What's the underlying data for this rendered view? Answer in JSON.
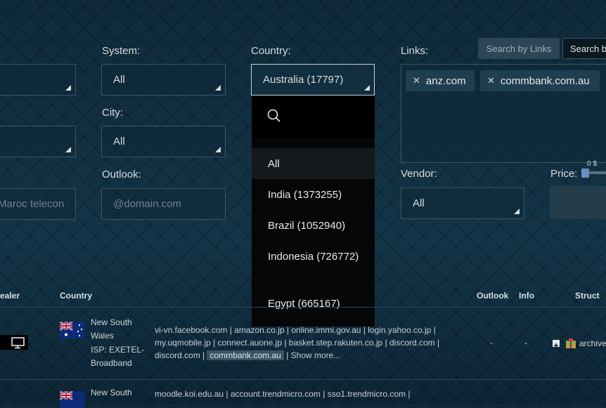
{
  "filters": {
    "left_col": {
      "isp_value": "Maroc telecon"
    },
    "system": {
      "label": "System:",
      "value": "All"
    },
    "city": {
      "label": "City:",
      "value": "All"
    },
    "outlook": {
      "label": "Outlook:",
      "placeholder": "@domain.com"
    },
    "country": {
      "label": "Country:",
      "value": "Australia (17797)"
    },
    "links": {
      "label": "Links:",
      "tags": [
        "anz.com",
        "commbank.com.au"
      ]
    },
    "vendor": {
      "label": "Vendor:",
      "value": "All"
    },
    "price": {
      "label": "Price:",
      "min_value": "0 $"
    }
  },
  "buttons": {
    "search_by_links": "Search by Links",
    "search_b": "Search b"
  },
  "dropdown": {
    "options": [
      "All",
      "India (1373255)",
      "Brazil (1052940)",
      "Indonesia (726772)",
      "Egypt (665167)"
    ]
  },
  "table": {
    "headers": {
      "dealer": "ealer",
      "country": "Country",
      "outlook": "Outlook",
      "info": "Info",
      "struct": "Struct"
    },
    "rows": [
      {
        "region": "New South Wales",
        "isp": "ISP: EXETEL-Broadband",
        "links_line1": "vi-vn.facebook.com | amazon.co.jp | online.immi.gov.au | login.yahoo.co.jp |",
        "links_line2": "my.uqmobile.jp | connect.auone.jp | basket.step.rakuten.co.jp | discord.com |",
        "links_line3_pre": "discord.com |",
        "links_line3_hl": "commbank.com.au",
        "links_line3_post": "| Show more...",
        "outlook": "-",
        "info": "-",
        "struct": "archive"
      },
      {
        "region": "New South",
        "links_line1": "moodle.koi.edu.au | account.trendmicro.com | sso1.trendmicro.com |"
      }
    ]
  }
}
